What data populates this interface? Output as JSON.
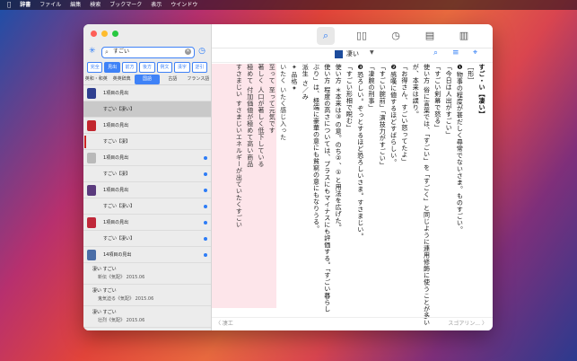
{
  "menubar": {
    "apple": "",
    "app": "辞書",
    "items": [
      "ファイル",
      "編集",
      "検索",
      "ブックマーク",
      "表示",
      "ウインドウ"
    ]
  },
  "sidebar": {
    "search_value": "すごい",
    "segments": [
      "完全",
      "見出",
      "前方",
      "後方",
      "例文",
      "漢字",
      "逆引"
    ],
    "active_segment": 1,
    "dict_tabs": [
      "英和・和英",
      "英英辞典",
      "国語",
      "古語",
      "フランス語"
    ],
    "active_dict_tab": 2,
    "rows": [
      {
        "label": "1項目の見出",
        "icon": "#2f3f8f",
        "dot": false,
        "sel": false
      },
      {
        "label": "すごい【凄い】",
        "icon": "",
        "dot": false,
        "sel": true
      },
      {
        "label": "1項目の見出",
        "icon": "#c2262e",
        "dot": false,
        "sel": false
      },
      {
        "label": "すごい【凄】",
        "icon": "",
        "dot": false,
        "sel": false,
        "bar": true
      },
      {
        "label": "1項目の見出",
        "icon": "#b9b9b9",
        "dot": true,
        "sel": false
      },
      {
        "label": "すごい【凄】",
        "icon": "",
        "dot": true,
        "sel": false
      },
      {
        "label": "1項目の見出",
        "icon": "#5b3b7e",
        "dot": true,
        "sel": false
      },
      {
        "label": "すごい【凄い】",
        "icon": "",
        "dot": true,
        "sel": false
      },
      {
        "label": "1項目の見出",
        "icon": "#c0283a",
        "dot": true,
        "sel": false
      },
      {
        "label": "すごい【凄い】",
        "icon": "",
        "dot": true,
        "sel": false
      },
      {
        "label": "14項目の見出",
        "icon": "#4a6da7",
        "dot": true,
        "sel": false
      }
    ],
    "subrows": [
      {
        "t": "凄い すごい",
        "s": "新伝《気配》 2015.06"
      },
      {
        "t": "凄い すごい",
        "s": "鬼気迫る《気配》 2015.06"
      },
      {
        "t": "凄い すごい",
        "s": "壮烈《気配》 2015.06"
      },
      {
        "t": "凄い すごい",
        "s": "黄ならず 2035.02"
      }
    ]
  },
  "toolbar": {
    "icons": [
      "search-icon",
      "book-icon",
      "history-icon",
      "list-icon",
      "library-icon"
    ]
  },
  "subbar": {
    "title": "凄い"
  },
  "entry": {
    "columns": [
      "すご・い【凄い】",
      "［形］",
      "❶物事の程度が甚だしく尋常でないさま。ものすごい。",
      "「今日は人出がすごい」",
      "「すごい剣幕で怒る」",
      "使い方 俗に言葉では、「すごい」を「すごく」と同じように連用修飾に使うことが多い",
      "が、本来は誤り。",
      "「お得さん、すごい怒ってたよ」",
      "❷感嘆に値するほどすばらしい。",
      "「すごい腕前」「演技力がすごい」",
      "「凄腕の刑事」",
      "❸恐ろしい。ぞっとするほど恐ろしいさま。すさまじい。",
      "「すごい形相で睨む」",
      "使い方 ＊本来は③の意。のち②、①と用法を広げた。",
      "使い方 程度の高さについては、プラスにもマイナスにも評価する。「すごい暮らし",
      "ぶり」は、極端に豪華の意にも貧窮の意にもなりうる。",
      "派生 さ／み",
      "✦品格✦",
      "いたく いたく感じ入った",
      "至って 至って元気です",
      "著しく 人口が著しく低下している",
      "極めて 付加価値が極めて高い商品",
      "すさまじい すさまじいエネルギーが出ていたくすごい"
    ]
  },
  "bottom": {
    "prev": "〈 凄工",
    "next": "スゴアリン... 〉"
  }
}
